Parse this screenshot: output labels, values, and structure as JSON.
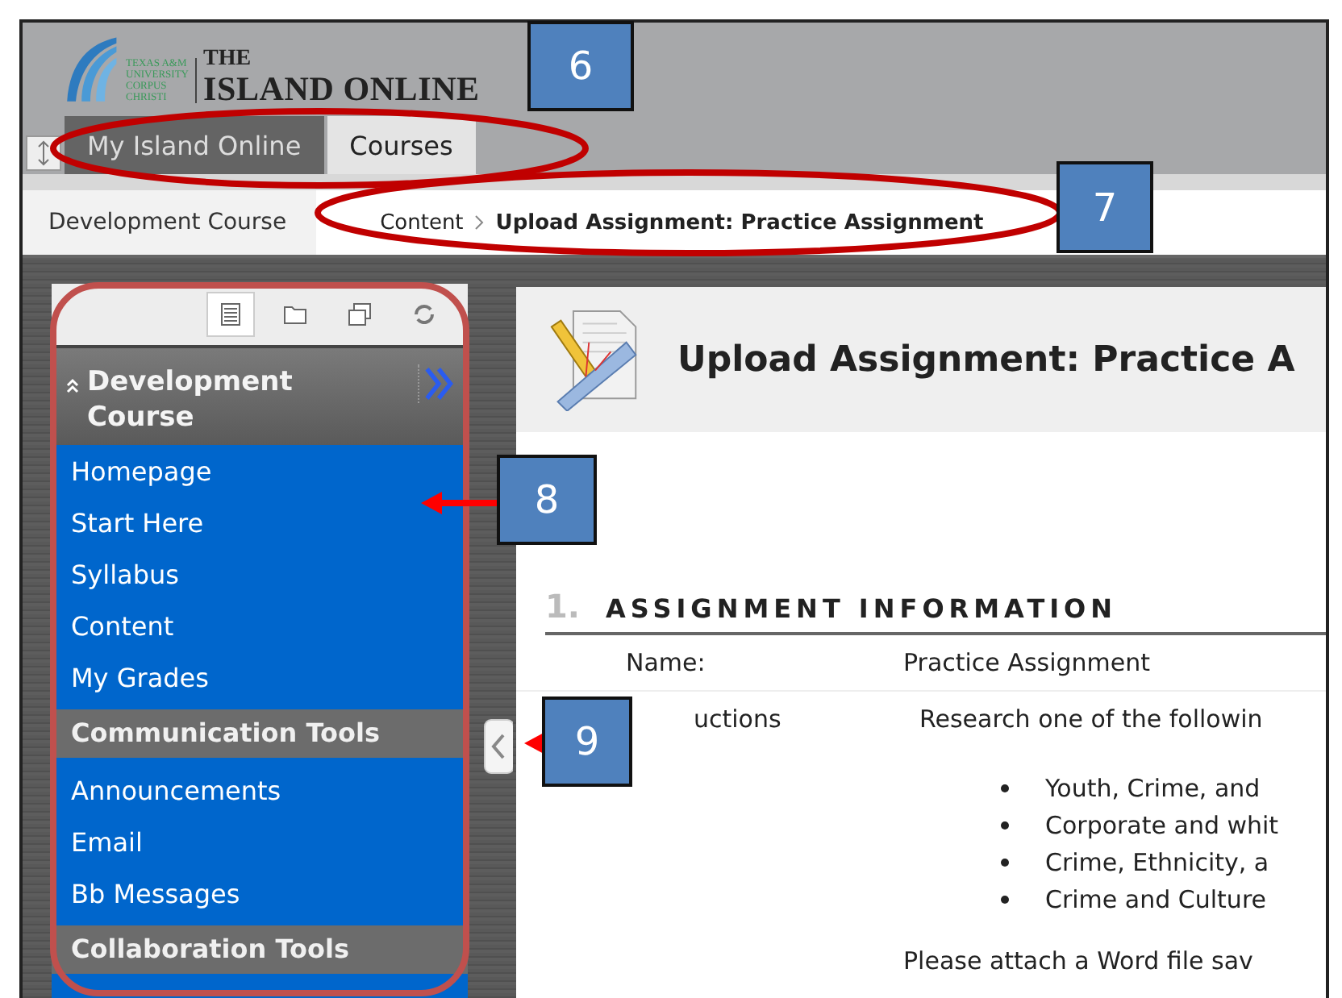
{
  "header": {
    "logo_lines": [
      "TEXAS A&M",
      "UNIVERSITY",
      "CORPUS",
      "CHRISTI"
    ],
    "title_small": "THE",
    "title": "ISLAND ONLINE"
  },
  "tabs": [
    {
      "label": "My Island Online",
      "selected": false
    },
    {
      "label": "Courses",
      "selected": true
    }
  ],
  "breadcrumb": {
    "course": "Development Course",
    "items": [
      {
        "label": "Content",
        "current": false
      },
      {
        "label": "Upload Assignment: Practice Assignment",
        "current": true
      }
    ]
  },
  "sidebar": {
    "toolbar": [
      {
        "kind": "list",
        "selected": true
      },
      {
        "kind": "folder",
        "selected": false
      },
      {
        "kind": "windows",
        "selected": false
      },
      {
        "kind": "refresh",
        "selected": false
      }
    ],
    "course_title": "Development Course",
    "menu": [
      {
        "kind": "link",
        "label": "Homepage"
      },
      {
        "kind": "link",
        "label": "Start Here"
      },
      {
        "kind": "link",
        "label": "Syllabus"
      },
      {
        "kind": "link",
        "label": "Content"
      },
      {
        "kind": "link",
        "label": "My Grades"
      },
      {
        "kind": "heading",
        "label": "Communication Tools"
      },
      {
        "kind": "link",
        "label": "Announcements"
      },
      {
        "kind": "link",
        "label": "Email"
      },
      {
        "kind": "link",
        "label": "Bb Messages"
      },
      {
        "kind": "heading",
        "label": "Collaboration Tools"
      }
    ]
  },
  "content": {
    "title": "Upload Assignment: Practice A",
    "section_number": "1.",
    "section_title": "ASSIGNMENT INFORMATION",
    "rows": [
      {
        "label": "Name:",
        "value": "Practice Assignment"
      },
      {
        "label": "uctions",
        "value": "Research one of the followin"
      }
    ],
    "bullets": [
      "Youth, Crime, and",
      "Corporate and whit",
      "Crime, Ethnicity, a",
      "Crime and Culture"
    ],
    "note": "Please attach a Word file sav"
  },
  "callouts": [
    {
      "number": "6"
    },
    {
      "number": "7"
    },
    {
      "number": "8"
    },
    {
      "number": "9"
    }
  ]
}
